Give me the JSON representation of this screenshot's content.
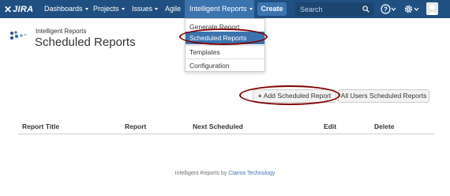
{
  "navbar": {
    "logo_text": "JIRA",
    "items": [
      {
        "label": "Dashboards"
      },
      {
        "label": "Projects"
      },
      {
        "label": "Issues"
      },
      {
        "label": "Agile"
      },
      {
        "label": "Intelligent Reports"
      }
    ],
    "create_label": "Create",
    "search_placeholder": "Search",
    "colors": {
      "bar": "#205081",
      "active": "#3b73af",
      "search_bg": "#1c4570"
    }
  },
  "header": {
    "breadcrumb": "Intelligent Reports",
    "title": "Scheduled Reports"
  },
  "dropdown": {
    "items": [
      {
        "label": "Generate Report"
      },
      {
        "label": "Scheduled Reports",
        "selected": true
      },
      {
        "label": "Templates"
      },
      {
        "label": "Configuration"
      }
    ]
  },
  "actions": {
    "add_label": "Add Scheduled Report",
    "all_users_label": "All Users Scheduled Reports"
  },
  "table": {
    "columns": [
      "Report Title",
      "Report",
      "Next Scheduled",
      "Edit",
      "Delete"
    ],
    "rows": []
  },
  "footer": {
    "text": "Intelligent Reports by",
    "link_text": "Clarios Technology"
  },
  "annotation_color": "#800000"
}
